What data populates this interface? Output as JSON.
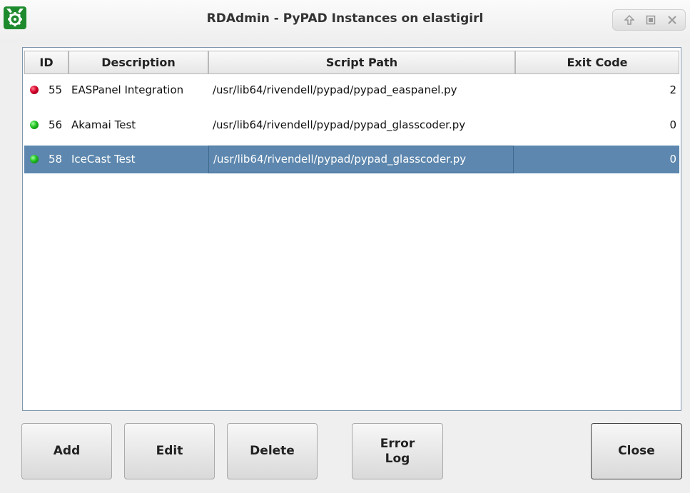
{
  "window": {
    "title": "RDAdmin - PyPAD Instances on elastigirl",
    "app_icon": "rivendell-gear-icon",
    "controls": [
      "up-arrow-icon",
      "maximize-icon",
      "close-icon"
    ]
  },
  "table": {
    "columns": [
      "ID",
      "Description",
      "Script Path",
      "Exit Code"
    ],
    "rows": [
      {
        "status": "red",
        "id": "55",
        "description": "EASPanel Integration",
        "path": "/usr/lib64/rivendell/pypad/pypad_easpanel.py",
        "exit_code": "2"
      },
      {
        "status": "green",
        "id": "56",
        "description": "Akamai Test",
        "path": "/usr/lib64/rivendell/pypad/pypad_glasscoder.py",
        "exit_code": "0"
      },
      {
        "status": "green",
        "id": "58",
        "description": "IceCast Test",
        "path": "/usr/lib64/rivendell/pypad/pypad_glasscoder.py",
        "exit_code": "0",
        "selected": true
      }
    ]
  },
  "buttons": {
    "add": "Add",
    "edit": "Edit",
    "delete": "Delete",
    "error_log_line1": "Error",
    "error_log_line2": "Log",
    "close": "Close"
  },
  "colors": {
    "selection": "#5d87ae",
    "status_red": "#d4002a",
    "status_green": "#1fbf1f",
    "app_icon": "#1e8a2e"
  }
}
